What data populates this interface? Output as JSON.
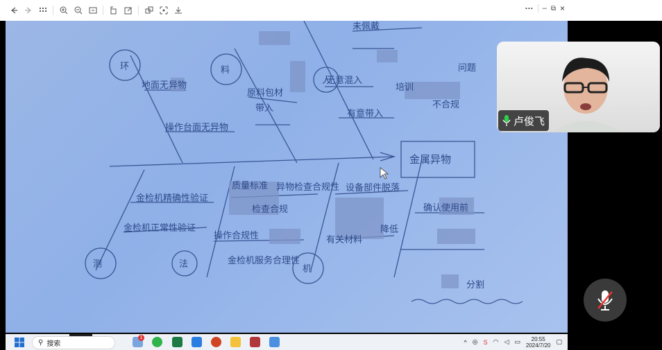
{
  "toolbar": {
    "icons": [
      "back-icon",
      "forward-icon",
      "grid-icon",
      "zoom-in-icon",
      "zoom-out-icon",
      "fit-icon",
      "rotate-icon",
      "edit-icon",
      "copy-icon",
      "crop-icon",
      "save-icon"
    ],
    "more": "···",
    "minimize": "–",
    "restore": "⧉",
    "close": "×"
  },
  "whiteboard": {
    "heads": {
      "env": "环",
      "material": "料",
      "person": "人",
      "measure": "测",
      "method": "法",
      "machine": "机"
    },
    "result": "金属异物",
    "labels": {
      "l1": "地面无异物",
      "l2": "操作台面无异物",
      "l3": "原料包材",
      "l4": "带入",
      "l5": "无意混入",
      "l6": "有意带入",
      "l7": "未佩戴",
      "l8": "培训",
      "l9": "不合规",
      "l10": "问题",
      "l11": "金检机精确性验证",
      "l12": "金检机正常性验证",
      "l13": "质量标准",
      "l14": "异物检查合规性",
      "l15": "检查合规",
      "l16": "操作合规性",
      "l17": "金检机服务合理性",
      "l18": "设备部件脱落",
      "l19": "有关材料",
      "l20": "确认使用前",
      "l21": "降低",
      "l22": "分割"
    }
  },
  "speaker": {
    "name": "卢俊飞"
  },
  "taskbar": {
    "search_placeholder": "搜索",
    "time": "20:55",
    "date": "2024/7/20",
    "badge": "1"
  }
}
